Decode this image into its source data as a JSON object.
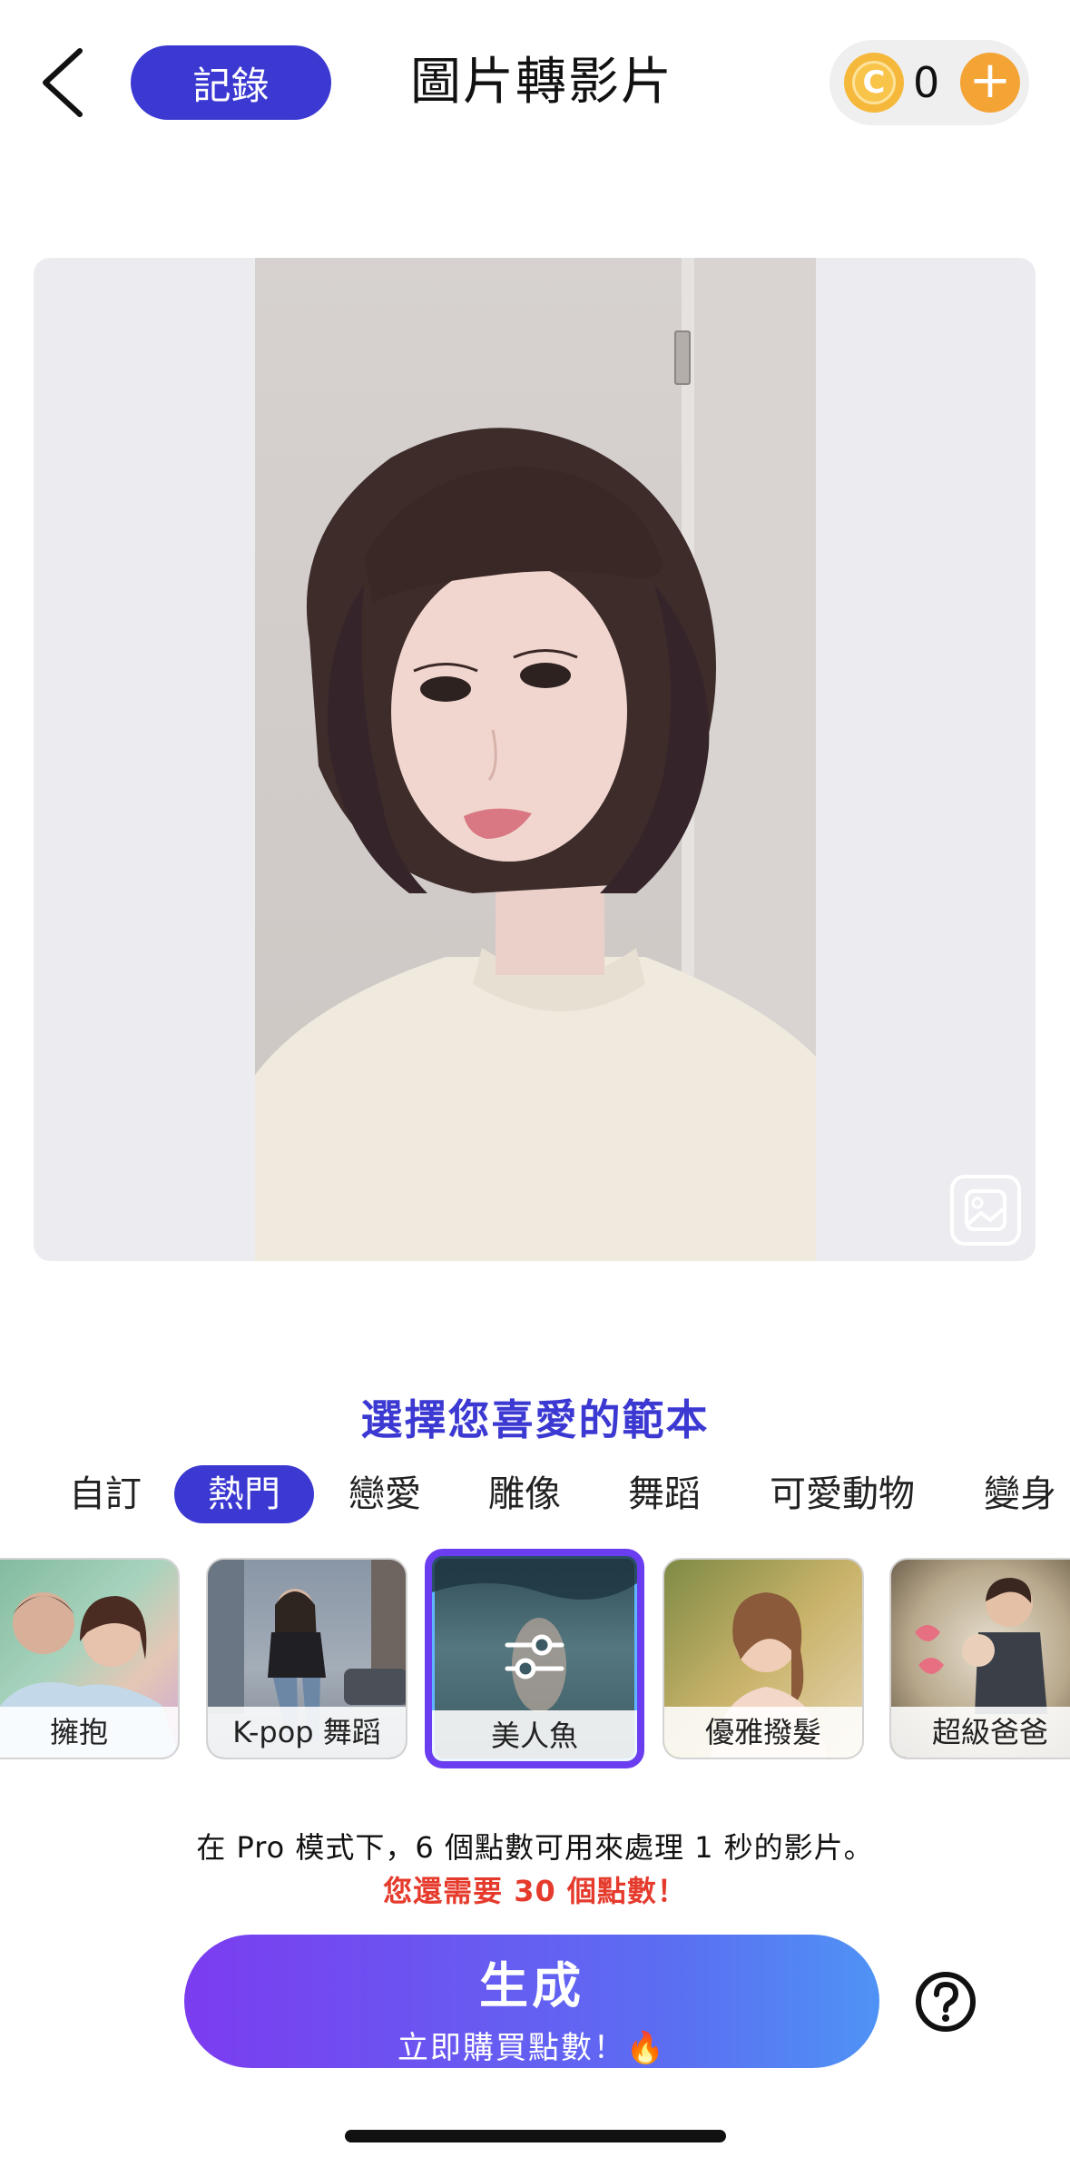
{
  "header": {
    "back_icon": "chevron-left-icon",
    "record_label": "記錄",
    "title": "圖片轉影片",
    "coin_icon": "coin-icon",
    "coin_symbol": "C",
    "coin_count": "0",
    "add_coin_symbol": "+"
  },
  "preview": {
    "gallery_icon": "gallery-icon"
  },
  "templates": {
    "heading": "選擇您喜愛的範本",
    "tabs": [
      {
        "label": "自訂",
        "active": false
      },
      {
        "label": "熱門",
        "active": true
      },
      {
        "label": "戀愛",
        "active": false
      },
      {
        "label": "雕像",
        "active": false
      },
      {
        "label": "舞蹈",
        "active": false
      },
      {
        "label": "可愛動物",
        "active": false
      },
      {
        "label": "變身",
        "active": false
      }
    ],
    "cards": [
      {
        "label": "擁抱",
        "selected": false
      },
      {
        "label": "K-pop 舞蹈",
        "selected": false
      },
      {
        "label": "美人魚",
        "selected": true
      },
      {
        "label": "優雅撥髮",
        "selected": false
      },
      {
        "label": "超級爸爸",
        "selected": false
      }
    ],
    "selected_icon": "sliders-icon"
  },
  "info": {
    "pro_mode": "在 Pro 模式下，6 個點數可用來處理 1 秒的影片。",
    "need_points": "您還需要 30 個點數！"
  },
  "generate": {
    "label": "生成",
    "sublabel": "立即購買點數！🔥"
  },
  "help_icon": "help-icon",
  "colors": {
    "accent": "#3c39d2",
    "warning": "#e53a2c",
    "coin": "#f4a335"
  }
}
